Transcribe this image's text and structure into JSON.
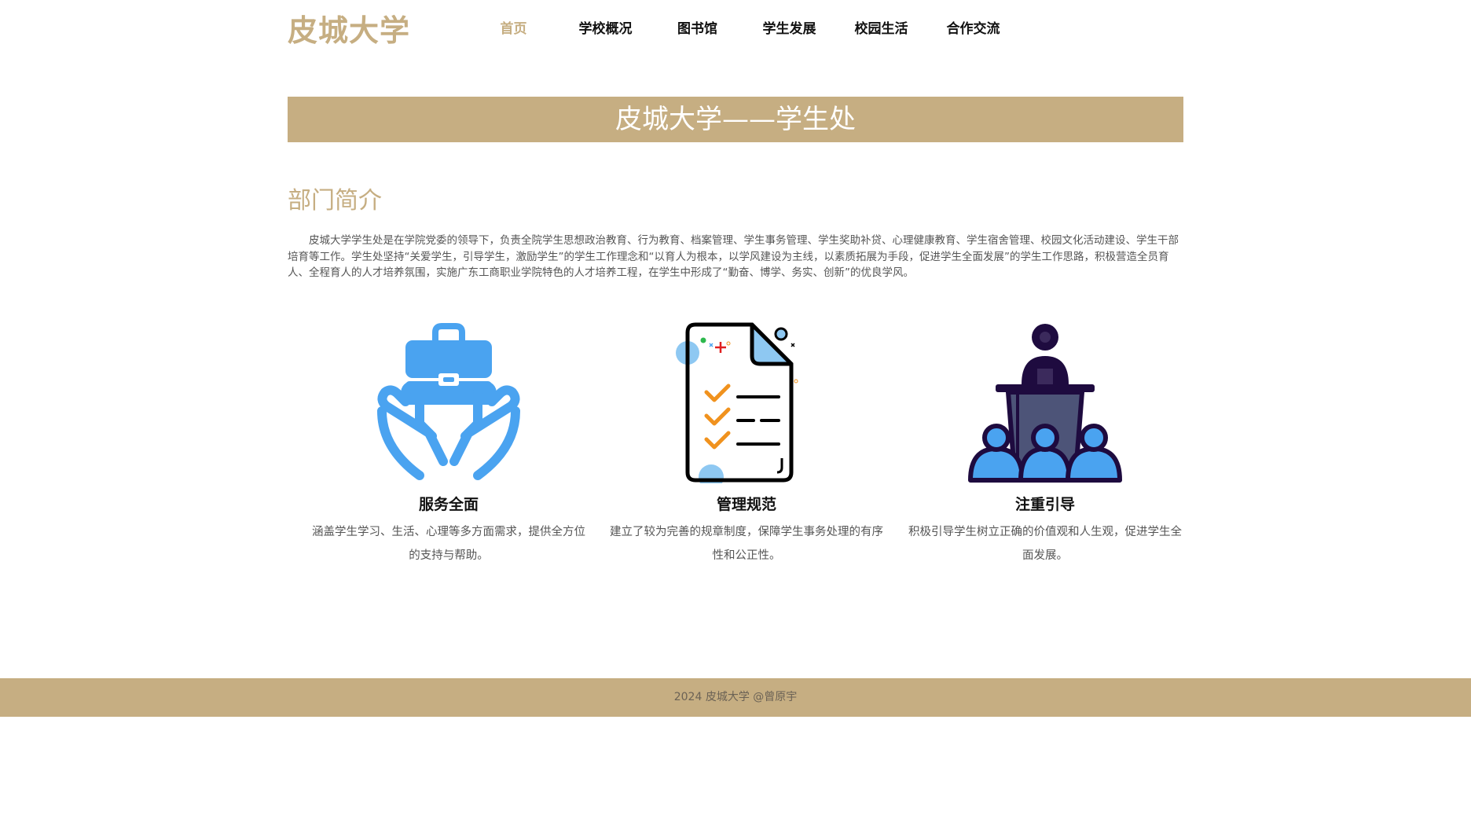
{
  "header": {
    "logo": "皮城大学",
    "nav": [
      "首页",
      "学校概况",
      "图书馆",
      "学生发展",
      "校园生活",
      "合作交流"
    ],
    "active_index": 0
  },
  "banner": {
    "title": "皮城大学——学生处"
  },
  "section": {
    "title": "部门简介",
    "text": "皮城大学学生处是在学院党委的领导下，负责全院学生思想政治教育、行为教育、档案管理、学生事务管理、学生奖助补贷、心理健康教育、学生宿舍管理、校园文化活动建设、学生干部培育等工作。学生处坚持“关爱学生，引导学生，激励学生”的学生工作理念和“以育人为根本，以学风建设为主线，以素质拓展为手段，促进学生全面发展”的学生工作思路，积极营造全员育人、全程育人的人才培养氛围，实施广东工商职业学院特色的人才培养工程，在学生中形成了“勤奋、博学、务实、创新”的优良学风。"
  },
  "features": [
    {
      "icon": "hands-briefcase-icon",
      "title": "服务全面",
      "desc": "涵盖学生学习、生活、心理等多方面需求，提供全方位的支持与帮助。"
    },
    {
      "icon": "checklist-document-icon",
      "title": "管理规范",
      "desc": "建立了较为完善的规章制度，保障学生事务处理的有序性和公正性。"
    },
    {
      "icon": "speaker-audience-icon",
      "title": "注重引导",
      "desc": "积极引导学生树立正确的价值观和人生观，促进学生全面发展。"
    }
  ],
  "footer": {
    "text": "2024 皮城大学 @曾原宇"
  },
  "colors": {
    "accent": "#c6ae82",
    "icon_blue": "#4aa3f0",
    "icon_navy": "#1e0b3f",
    "check_orange": "#f0921e"
  }
}
